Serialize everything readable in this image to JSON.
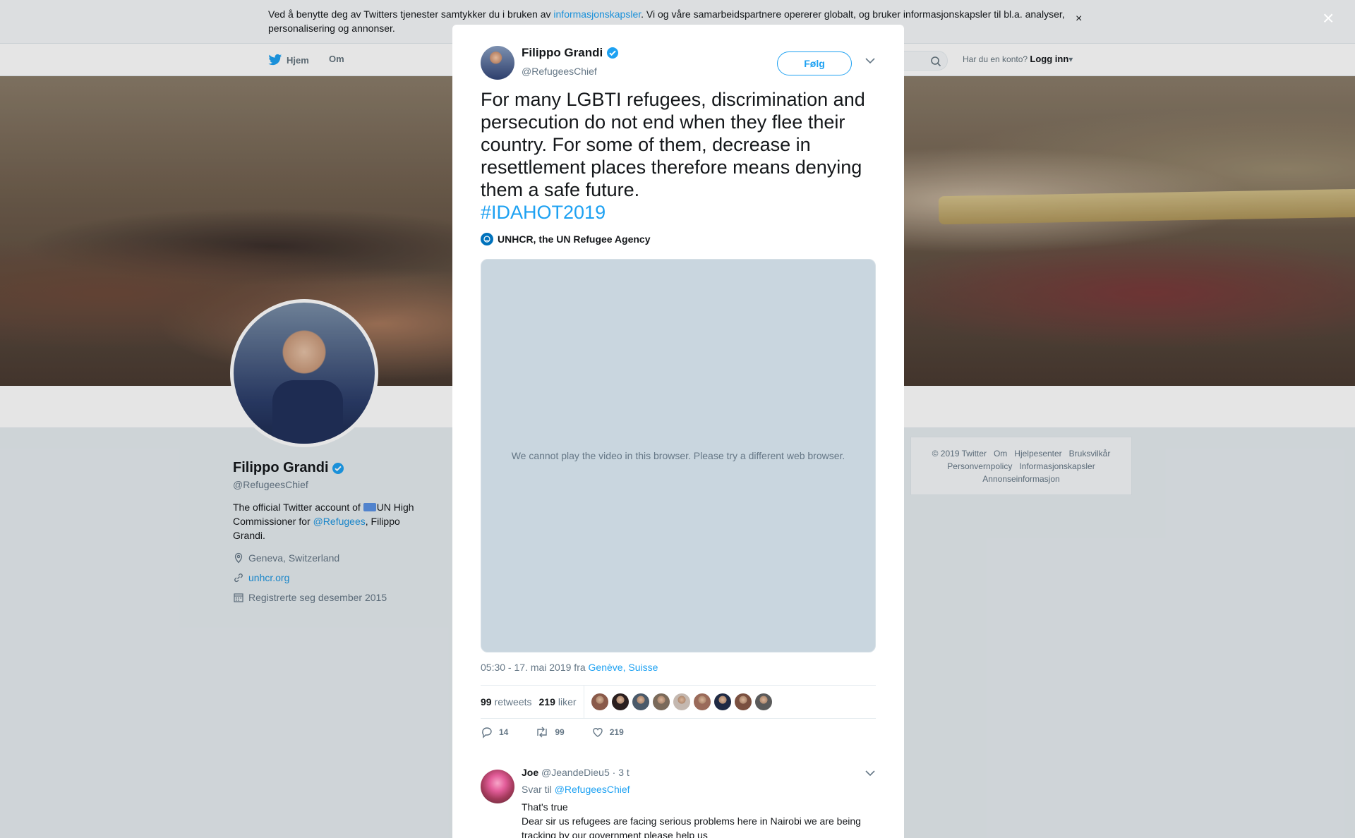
{
  "cookie_bar": {
    "text_before": "Ved å benytte deg av Twitters tjenester samtykker du i bruken av ",
    "link": "informasjonskapsler",
    "text_after": ". Vi og våre samarbeidspartnere opererer globalt, og bruker informasjonskapsler til bl.a. analyser, personalisering og annonser.",
    "close": "×"
  },
  "topnav": {
    "home": "Hjem",
    "about": "Om",
    "account_prompt": "Har du en konto?",
    "login": "Logg inn"
  },
  "profile": {
    "name": "Filippo Grandi",
    "handle": "@RefugeesChief",
    "bio_before": "The official Twitter account of ",
    "bio_org": "UN High Commissioner for ",
    "bio_link": "@Refugees",
    "bio_after": ", Filippo Grandi.",
    "location": "Geneva, Switzerland",
    "url": "unhcr.org",
    "joined": "Registrerte seg desember 2015"
  },
  "footer": {
    "items": [
      "© 2019 Twitter",
      "Om",
      "Hjelpesenter",
      "Bruksvilkår",
      "Personvernpolicy",
      "Informasjonskapsler",
      "Annonseinformasjon"
    ]
  },
  "overlay": {
    "close": "×"
  },
  "tweet": {
    "author_name": "Filippo Grandi",
    "author_handle": "@RefugeesChief",
    "follow_label": "Følg",
    "text": "For many LGBTI refugees, discrimination and persecution do not end when they flee their country. For some of them, decrease in resettlement places therefore means denying them a safe future.",
    "hashtag": "#IDAHOT2019",
    "source": "UNHCR, the UN Refugee Agency",
    "video_message": "We cannot play the video in this browser. Please try a different web browser.",
    "timestamp": "05:30 - 17. mai 2019 fra ",
    "place": "Genève, Suisse",
    "retweets_count": "99",
    "retweets_label": "retweets",
    "likes_count": "219",
    "likes_label": "liker",
    "reply_count": "14",
    "retweet_action_count": "99",
    "like_action_count": "219",
    "liker_colors": [
      "#8a5a4a",
      "#2a1f1f",
      "#4a5a6a",
      "#7a6a5a",
      "#c4b8b0",
      "#9a6a5a",
      "#1f2a44",
      "#7a5040",
      "#5a5a5a"
    ]
  },
  "reply": {
    "name": "Joe",
    "handle": "@JeandeDieu5",
    "time": "· 3 t",
    "reply_to_label": "Svar til ",
    "reply_to_link": "@RefugeesChief",
    "line1": "That's true",
    "line2": "Dear sir us  refugees are facing serious problems here in Nairobi we are being tracking by our government please help us"
  },
  "colors": {
    "accent": "#1da1f2",
    "verified": "#1da1f2"
  }
}
